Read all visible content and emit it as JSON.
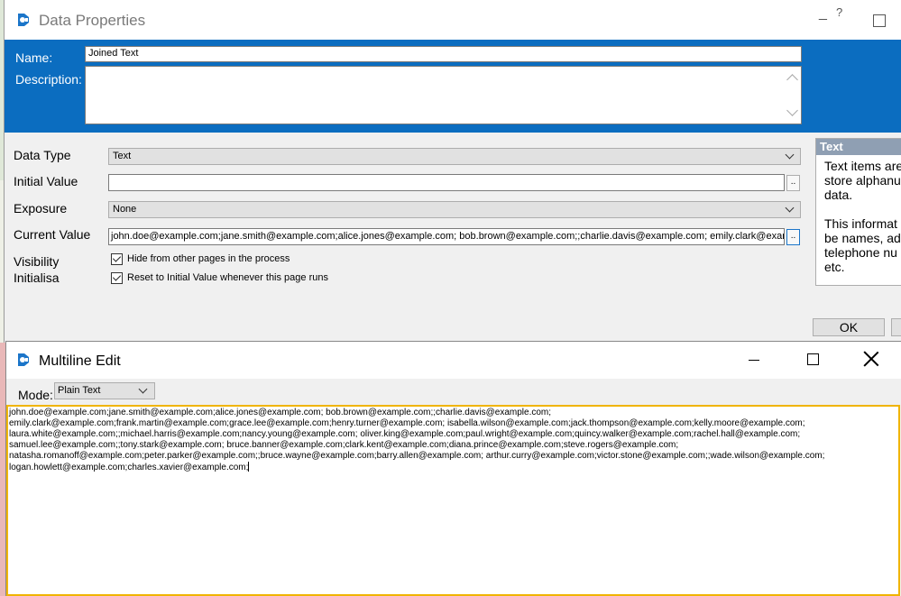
{
  "data_properties": {
    "title": "Data Properties",
    "help_glyph": "?",
    "minimize_glyph": "_",
    "header": {
      "name_label": "Name:",
      "name_value": "Joined Text",
      "description_label": "Description:",
      "description_value": ""
    },
    "form": {
      "data_type_label": "Data Type",
      "data_type_value": "Text",
      "initial_value_label": "Initial Value",
      "initial_value": "",
      "exposure_label": "Exposure",
      "exposure_value": "None",
      "current_value_label": "Current Value",
      "current_value": "john.doe@example.com;jane.smith@example.com;alice.jones@example.com; bob.brown@example.com;;charlie.davis@example.com; emily.clark@example.com;frank.mart",
      "dots_label": "..",
      "visibility_label": "Visibility",
      "initialisation_label": "Initialisa",
      "hide_checkbox_label": "Hide from other pages in the process",
      "hide_checked": true,
      "reset_checkbox_label": "Reset to Initial Value whenever this page runs",
      "reset_checked": true
    },
    "help_panel": {
      "title": "Text",
      "body": "Text items are\nstore alphanu\ndata.\n\nThis informat\nbe names, ad\ntelephone nu\netc."
    },
    "ok_label": "OK"
  },
  "multiline_edit": {
    "title": "Multiline Edit",
    "mode_label": "Mode:",
    "mode_value": "Plain Text",
    "lines": [
      "john.doe@example.com;jane.smith@example.com;alice.jones@example.com; bob.brown@example.com;;charlie.davis@example.com;",
      "emily.clark@example.com;frank.martin@example.com;grace.lee@example.com;henry.turner@example.com; isabella.wilson@example.com;jack.thompson@example.com;kelly.moore@example.com;",
      "laura.white@example.com;;michael.harris@example.com;nancy.young@example.com; oliver.king@example.com;paul.wright@example.com;quincy.walker@example.com;rachel.hall@example.com;",
      "samuel.lee@example.com;;tony.stark@example.com; bruce.banner@example.com;clark.kent@example.com;diana.prince@example.com;steve.rogers@example.com;",
      "natasha.romanoff@example.com;peter.parker@example.com;;bruce.wayne@example.com;barry.allen@example.com; arthur.curry@example.com;victor.stone@example.com;;wade.wilson@example.com;",
      "logan.howlett@example.com;charles.xavier@example.com;"
    ]
  },
  "colors": {
    "header_blue": "#0b6dc0",
    "focus_border": "#f0b400",
    "help_title_bg": "#8f9fb3"
  },
  "icons": {
    "app_logo": "blue-prism-logo-icon",
    "dropdown": "chevron-down-icon",
    "checkbox": "check-icon"
  }
}
